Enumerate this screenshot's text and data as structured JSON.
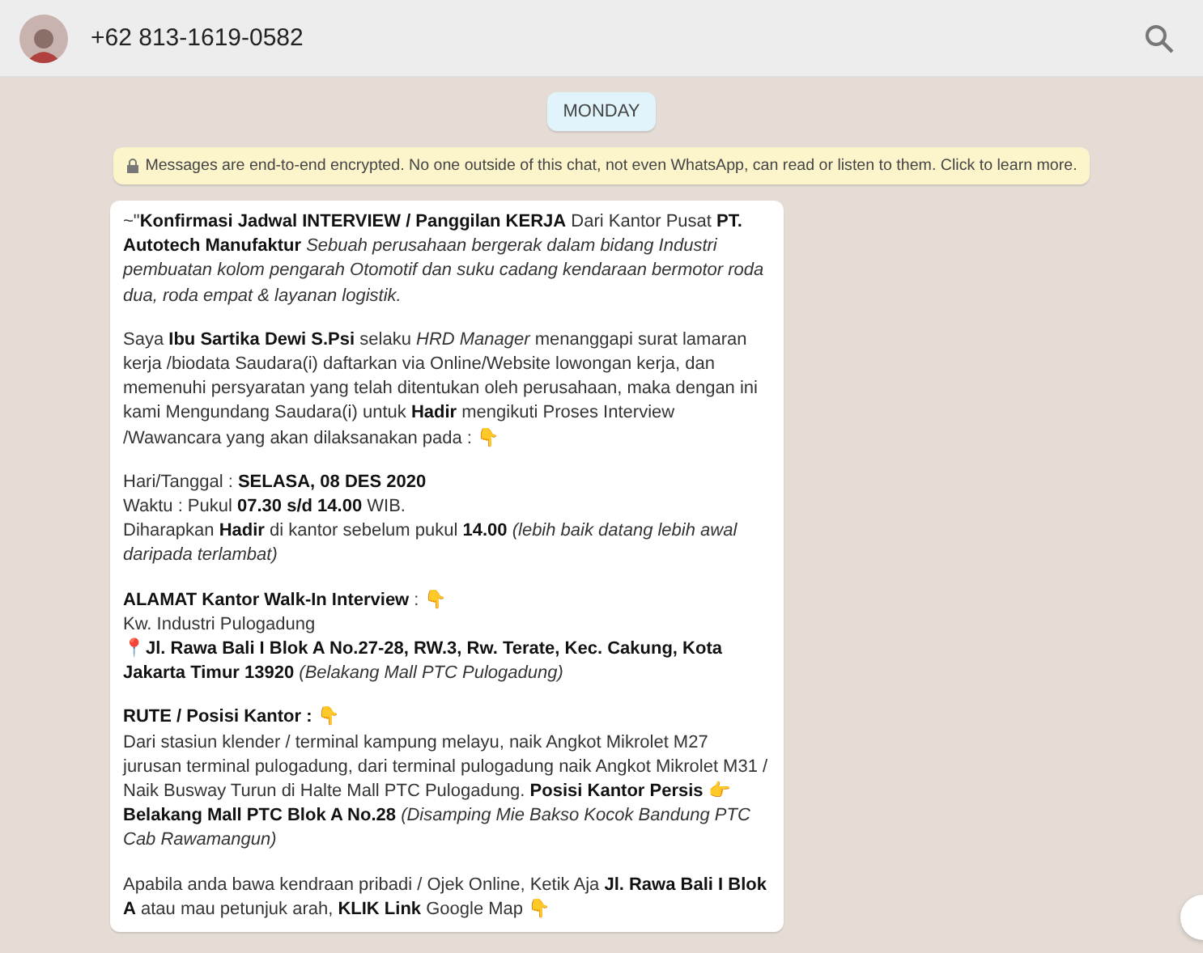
{
  "header": {
    "contact": "+62 813-1619-0582"
  },
  "date_badge": "MONDAY",
  "encryption_notice": "Messages are end-to-end encrypted. No one outside of this chat, not even WhatsApp, can read or listen to them. Click to learn more.",
  "message": {
    "paragraphs": [
      [
        "~\"**Konfirmasi Jadwal INTERVIEW / Panggilan KERJA** Dari Kantor Pusat **PT. Autotech Manufaktur** *Sebuah perusahaan bergerak dalam bidang Industri pembuatan kolom pengarah Otomotif dan suku cadang kendaraan bermotor roda dua, roda empat & layanan logistik.*"
      ],
      [
        "Saya **Ibu Sartika Dewi S.Psi** selaku *HRD Manager* menanggapi surat lamaran kerja /biodata Saudara(i) daftarkan via Online/Website lowongan kerja, dan memenuhi persyaratan yang telah ditentukan oleh perusahaan, maka dengan ini kami Mengundang Saudara(i) untuk **Hadir** mengikuti Proses Interview /Wawancara yang akan dilaksanakan pada : 👇"
      ],
      [
        "Hari/Tanggal : **SELASA, 08 DES 2020**",
        "Waktu : Pukul **07.30 s/d 14.00** WIB.",
        "Diharapkan **Hadir** di kantor sebelum pukul **14.00** *(lebih baik datang lebih awal daripada terlambat)*"
      ],
      [
        "**ALAMAT Kantor Walk-In Interview** : 👇",
        "Kw. Industri Pulogadung",
        "📍**Jl. Rawa Bali I Blok A No.27-28, RW.3, Rw. Terate, Kec. Cakung, Kota Jakarta Timur 13920** *(Belakang Mall PTC Pulogadung)*"
      ],
      [
        "**RUTE / Posisi Kantor :** 👇",
        "Dari stasiun klender / terminal kampung melayu, naik Angkot Mikrolet M27 jurusan terminal pulogadung, dari terminal pulogadung naik Angkot Mikrolet M31 / Naik Busway Turun di Halte Mall PTC Pulogadung. **Posisi Kantor Persis 👉 Belakang Mall PTC Blok A No.28** *(Disamping Mie Bakso Kocok Bandung PTC Cab Rawamangun)*"
      ],
      [
        "Apabila anda bawa kendraan pribadi / Ojek Online, Ketik Aja **Jl. Rawa Bali I Blok A** atau mau petunjuk arah, **KLIK Link** Google Map 👇"
      ]
    ]
  }
}
